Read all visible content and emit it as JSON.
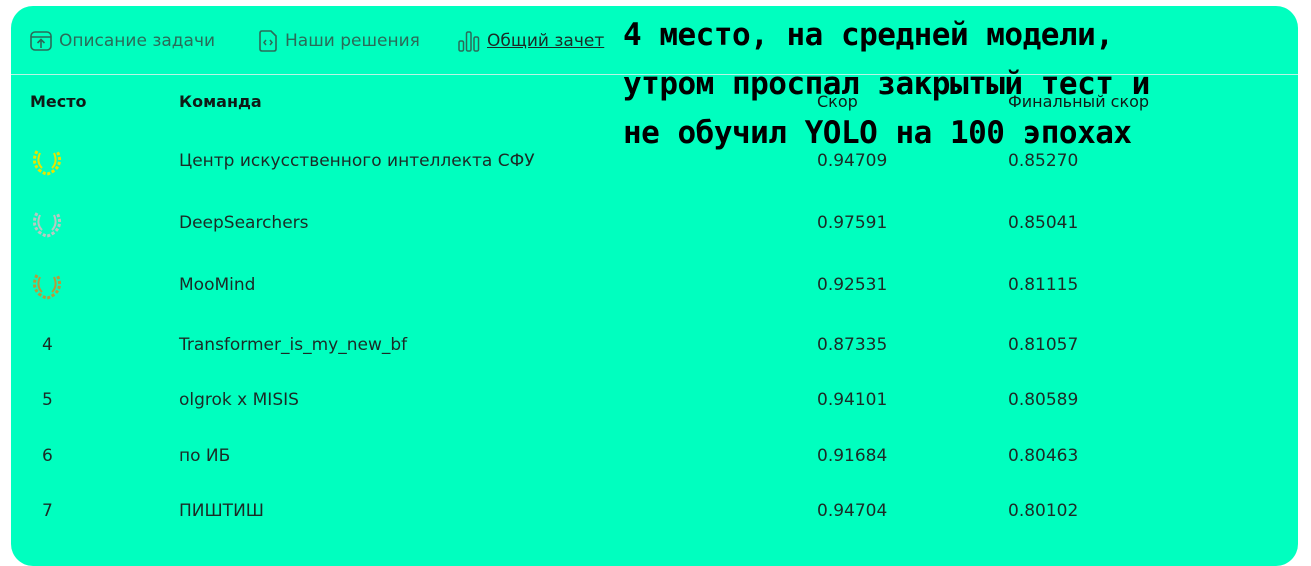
{
  "tabs": [
    {
      "label": "Описание задачи",
      "icon": "upload-icon",
      "active": false
    },
    {
      "label": "Наши решения",
      "icon": "code-file-icon",
      "active": false
    },
    {
      "label": "Общий зачет",
      "icon": "bar-chart-icon",
      "active": true
    }
  ],
  "table": {
    "headers": {
      "place": "Место",
      "team": "Команда",
      "score": "Скор",
      "final_score": "Финальный скор"
    },
    "rows": [
      {
        "place": "",
        "medal": "gold",
        "team": "Центр искусственного интеллекта СФУ",
        "score": "0.94709",
        "final": "0.85270"
      },
      {
        "place": "",
        "medal": "silver",
        "team": "DeepSearchers",
        "score": "0.97591",
        "final": "0.85041"
      },
      {
        "place": "",
        "medal": "bronze",
        "team": "MooMind",
        "score": "0.92531",
        "final": "0.81115"
      },
      {
        "place": "4",
        "medal": "",
        "team": "Transformer_is_my_new_bf",
        "score": "0.87335",
        "final": "0.81057"
      },
      {
        "place": "5",
        "medal": "",
        "team": "olgrok x MISIS",
        "score": "0.94101",
        "final": "0.80589"
      },
      {
        "place": "6",
        "medal": "",
        "team": "по ИБ",
        "score": "0.91684",
        "final": "0.80463"
      },
      {
        "place": "7",
        "medal": "",
        "team": "ПИШТИШ",
        "score": "0.94704",
        "final": "0.80102"
      }
    ]
  },
  "overlay_text": {
    "line1": "4 место, на средней модели,",
    "line2": "утром проспал закрытый тест и",
    "line3": "не обучил YOLO на 100 эпохах"
  },
  "colors": {
    "background": "#00ffbf",
    "gold": "#e6e600",
    "silver": "#b9c8c2",
    "bronze": "#b89a3a"
  }
}
